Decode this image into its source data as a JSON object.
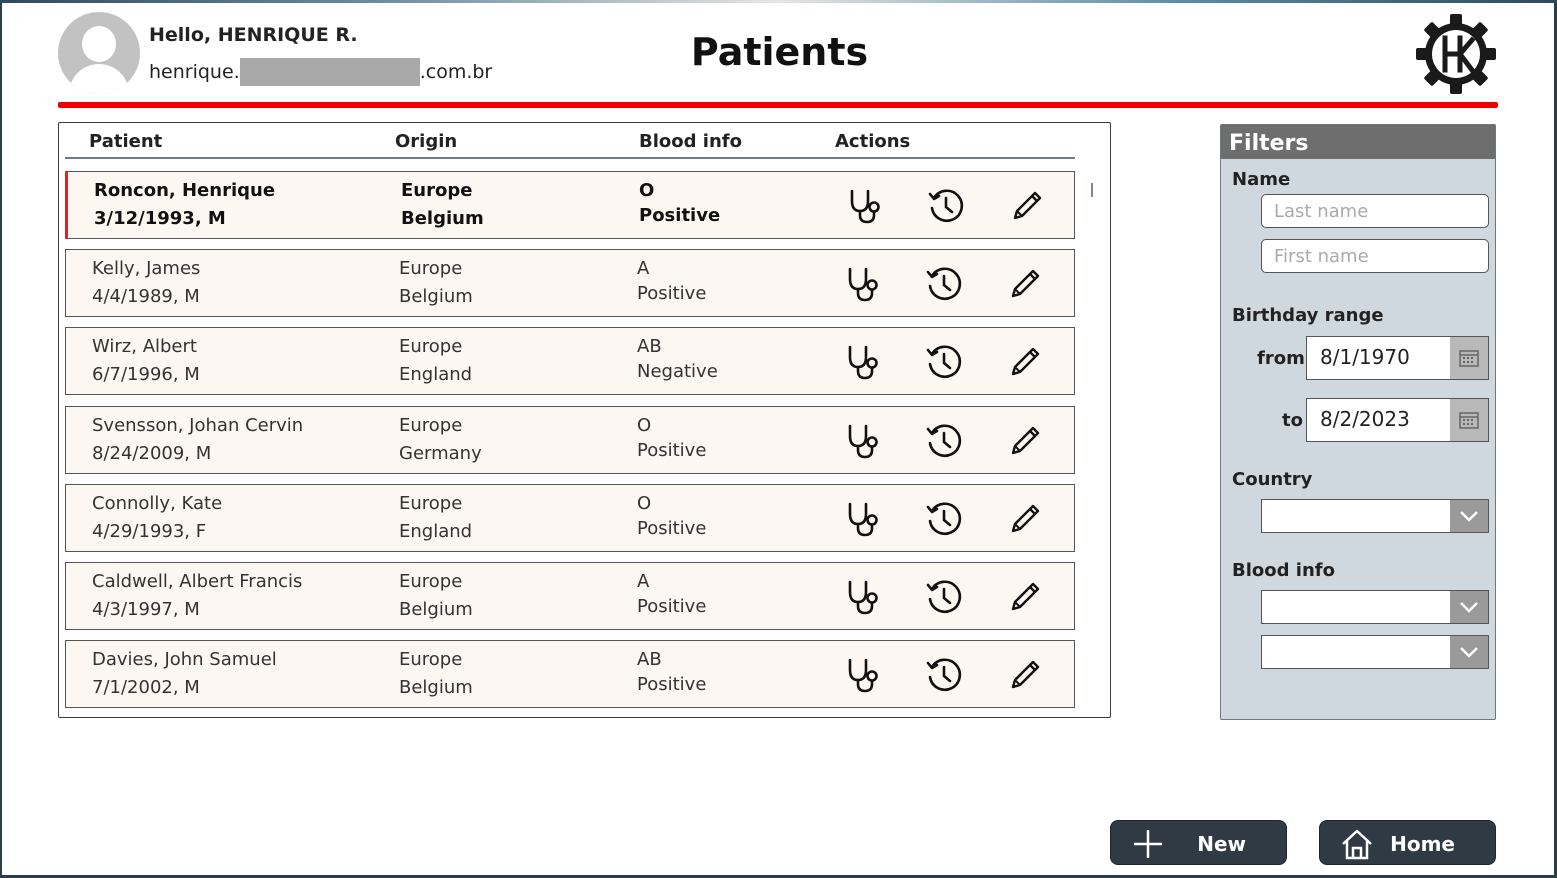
{
  "header": {
    "greeting": "Hello, HENRIQUE R.",
    "email_prefix": "henrique.",
    "email_suffix": ".com.br",
    "title": "Patients"
  },
  "table": {
    "columns": [
      "Patient",
      "Origin",
      "Blood info",
      "Actions"
    ],
    "rows": [
      {
        "name": "Roncon, Henrique",
        "dob": "3/12/1993, M",
        "region": "Europe",
        "country": "Belgium",
        "blood_type": "O",
        "rh": "Positive",
        "selected": true
      },
      {
        "name": "Kelly, James",
        "dob": "4/4/1989, M",
        "region": "Europe",
        "country": "Belgium",
        "blood_type": "A",
        "rh": "Positive",
        "selected": false
      },
      {
        "name": "Wirz, Albert",
        "dob": "6/7/1996, M",
        "region": "Europe",
        "country": "England",
        "blood_type": "AB",
        "rh": "Negative",
        "selected": false
      },
      {
        "name": "Svensson, Johan Cervin",
        "dob": "8/24/2009, M",
        "region": "Europe",
        "country": "Germany",
        "blood_type": "O",
        "rh": "Positive",
        "selected": false
      },
      {
        "name": "Connolly, Kate",
        "dob": "4/29/1993, F",
        "region": "Europe",
        "country": "England",
        "blood_type": "O",
        "rh": "Positive",
        "selected": false
      },
      {
        "name": "Caldwell, Albert Francis",
        "dob": "4/3/1997, M",
        "region": "Europe",
        "country": "Belgium",
        "blood_type": "A",
        "rh": "Positive",
        "selected": false
      },
      {
        "name": "Davies, John Samuel",
        "dob": "7/1/2002, M",
        "region": "Europe",
        "country": "Belgium",
        "blood_type": "AB",
        "rh": "Positive",
        "selected": false
      }
    ],
    "action_icons": [
      "stethoscope-icon",
      "history-icon",
      "pencil-icon"
    ]
  },
  "filters": {
    "title": "Filters",
    "name_label": "Name",
    "last_name_placeholder": "Last name",
    "first_name_placeholder": "First name",
    "birthday_label": "Birthday range",
    "from_label": "from",
    "from_value": "8/1/1970",
    "to_label": "to",
    "to_value": "8/2/2023",
    "country_label": "Country",
    "blood_label": "Blood info"
  },
  "buttons": {
    "new_label": "New",
    "home_label": "Home"
  },
  "colors": {
    "accent_red": "#ee0000",
    "button_dark": "#2f3a45",
    "filter_bg": "#cfd8de",
    "row_bg": "#fdf7f1"
  }
}
